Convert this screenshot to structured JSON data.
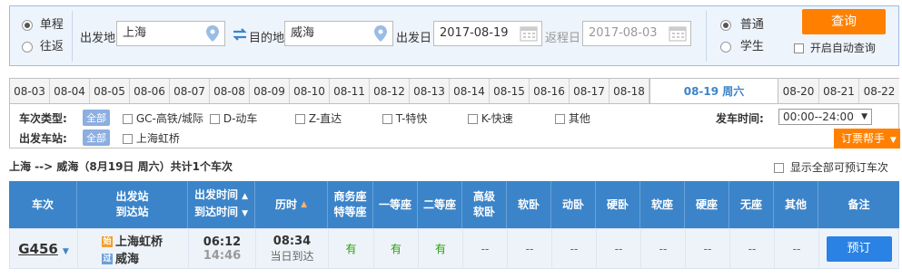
{
  "search": {
    "trip_one_way": "单程",
    "trip_round": "往返",
    "from_label": "出发地",
    "from_value": "上海",
    "to_label": "目的地",
    "to_value": "威海",
    "depart_label": "出发日",
    "depart_value": "2017-08-19",
    "return_label": "返程日",
    "return_value": "2017-08-03",
    "ticket_normal": "普通",
    "ticket_student": "学生",
    "query_label": "查询",
    "auto_query_label": "开启自动查询"
  },
  "dates": [
    "08-03",
    "08-04",
    "08-05",
    "08-06",
    "08-07",
    "08-08",
    "08-09",
    "08-10",
    "08-11",
    "08-12",
    "08-13",
    "08-14",
    "08-15",
    "08-16",
    "08-17",
    "08-18",
    "08-19 周六",
    "08-20",
    "08-21",
    "08-22"
  ],
  "filters": {
    "train_type_label": "车次类型:",
    "all_label": "全部",
    "types": [
      "GC-高铁/城际",
      "D-动车",
      "Z-直达",
      "T-特快",
      "K-快速",
      "其他"
    ],
    "station_label": "出发车站:",
    "stations": [
      "上海虹桥"
    ],
    "time_label": "发车时间:",
    "time_value": "00:00--24:00",
    "helper_label": "订票帮手"
  },
  "summary": {
    "route": "上海 --> 威海（8月19日  周六）共计",
    "count": "1",
    "suffix": "个车次",
    "show_all_label": "显示全部可预订车次"
  },
  "table": {
    "headers": {
      "train": "车次",
      "station_a": "出发站",
      "station_b": "到达站",
      "time_a": "出发时间",
      "time_b": "到达时间",
      "duration": "历时",
      "business_a": "商务座",
      "business_b": "特等座",
      "first": "一等座",
      "second": "二等座",
      "adv_a": "高级",
      "adv_b": "软卧",
      "soft_sleeper": "软卧",
      "motor_sleeper": "动卧",
      "hard_sleeper": "硬卧",
      "soft_seat": "软座",
      "hard_seat": "硬座",
      "no_seat": "无座",
      "other": "其他",
      "note": "备注"
    },
    "row": {
      "train_no": "G456",
      "from_badge": "始",
      "to_badge": "过",
      "from_station": "上海虹桥",
      "to_station": "威海",
      "depart": "06:12",
      "arrive": "14:46",
      "duration": "08:34",
      "arrive_day": "当日到达",
      "business": "有",
      "first": "有",
      "second": "有",
      "adv_soft": "--",
      "soft_sleeper": "--",
      "motor_sleeper": "--",
      "hard_sleeper": "--",
      "soft_seat": "--",
      "hard_seat": "--",
      "no_seat": "--",
      "other": "--",
      "book_label": "预订"
    }
  },
  "colors": {
    "accent": "#3b84c9",
    "orange": "#ff8000",
    "available": "#26a306"
  }
}
